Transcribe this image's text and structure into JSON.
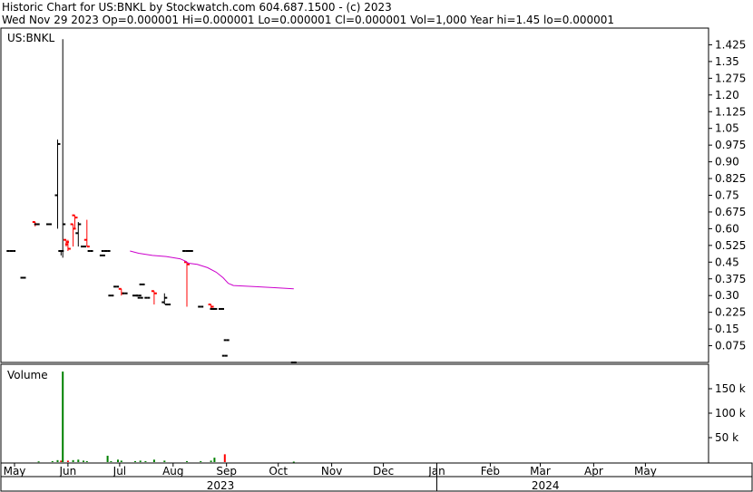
{
  "header": {
    "title": "Historic Chart for US:BNKL by Stockwatch.com 604.687.1500 - (c) 2023",
    "stats": "Wed Nov 29 2023   Op=0.000001  Hi=0.000001  Lo=0.000001  Cl=0.000001  Vol=1,000   Year hi=1.45  lo=0.000001"
  },
  "chart_data": [
    {
      "type": "ohlc",
      "symbol_label": "US:BNKL",
      "x_unit": "days since 2023-05-01",
      "ylim": [
        0,
        1.5
      ],
      "y_ticks": [
        "1.425",
        "1.35",
        "1.275",
        "1.20",
        "1.125",
        "1.05",
        "0.975",
        "0.90",
        "0.825",
        "0.75",
        "0.675",
        "0.60",
        "0.525",
        "0.45",
        "0.375",
        "0.30",
        "0.225",
        "0.15",
        "0.075"
      ],
      "y_tick_values": [
        1.425,
        1.35,
        1.275,
        1.2,
        1.125,
        1.05,
        0.975,
        0.9,
        0.825,
        0.75,
        0.675,
        0.6,
        0.525,
        0.45,
        0.375,
        0.3,
        0.225,
        0.15,
        0.075
      ],
      "colors": {
        "up": "#000000",
        "down": "#ff0000",
        "moving_average": "#cc00cc"
      },
      "series": [
        {
          "name": "price",
          "bars": [
            {
              "d": -3,
              "o": 0.5,
              "h": 0.5,
              "l": 0.5,
              "c": 0.5
            },
            {
              "d": -1,
              "o": 0.5,
              "h": 0.5,
              "l": 0.5,
              "c": 0.5
            },
            {
              "d": 5,
              "o": 0.38,
              "h": 0.38,
              "l": 0.38,
              "c": 0.38
            },
            {
              "d": 12,
              "o": 0.63,
              "h": 0.63,
              "l": 0.61,
              "c": 0.62
            },
            {
              "d": 13,
              "o": 0.62,
              "h": 0.62,
              "l": 0.62,
              "c": 0.62
            },
            {
              "d": 20,
              "o": 0.62,
              "h": 0.62,
              "l": 0.62,
              "c": 0.62
            },
            {
              "d": 25,
              "o": 0.75,
              "h": 1.0,
              "l": 0.6,
              "c": 0.98
            },
            {
              "d": 27,
              "o": 0.5,
              "h": 0.5,
              "l": 0.48,
              "c": 0.5
            },
            {
              "d": 28,
              "o": 0.5,
              "h": 1.45,
              "l": 0.47,
              "c": 0.62
            },
            {
              "d": 30,
              "o": 0.55,
              "h": 0.55,
              "l": 0.52,
              "c": 0.54
            },
            {
              "d": 31,
              "o": 0.53,
              "h": 0.55,
              "l": 0.5,
              "c": 0.51
            },
            {
              "d": 34,
              "o": 0.62,
              "h": 0.62,
              "l": 0.52,
              "c": 0.6
            },
            {
              "d": 35,
              "o": 0.66,
              "h": 0.66,
              "l": 0.6,
              "c": 0.65
            },
            {
              "d": 37,
              "o": 0.58,
              "h": 0.63,
              "l": 0.52,
              "c": 0.62
            },
            {
              "d": 40,
              "o": 0.52,
              "h": 0.52,
              "l": 0.52,
              "c": 0.52
            },
            {
              "d": 42,
              "o": 0.55,
              "h": 0.64,
              "l": 0.52,
              "c": 0.52
            },
            {
              "d": 44,
              "o": 0.5,
              "h": 0.5,
              "l": 0.5,
              "c": 0.5
            },
            {
              "d": 51,
              "o": 0.48,
              "h": 0.48,
              "l": 0.48,
              "c": 0.48
            },
            {
              "d": 52,
              "o": 0.5,
              "h": 0.5,
              "l": 0.5,
              "c": 0.5
            },
            {
              "d": 54,
              "o": 0.5,
              "h": 0.5,
              "l": 0.5,
              "c": 0.5
            },
            {
              "d": 56,
              "o": 0.3,
              "h": 0.3,
              "l": 0.3,
              "c": 0.3
            },
            {
              "d": 59,
              "o": 0.34,
              "h": 0.34,
              "l": 0.34,
              "c": 0.34
            },
            {
              "d": 62,
              "o": 0.33,
              "h": 0.33,
              "l": 0.3,
              "c": 0.31
            },
            {
              "d": 64,
              "o": 0.31,
              "h": 0.31,
              "l": 0.31,
              "c": 0.31
            },
            {
              "d": 70,
              "o": 0.3,
              "h": 0.3,
              "l": 0.3,
              "c": 0.3
            },
            {
              "d": 72,
              "o": 0.3,
              "h": 0.3,
              "l": 0.3,
              "c": 0.3
            },
            {
              "d": 73,
              "o": 0.29,
              "h": 0.29,
              "l": 0.29,
              "c": 0.29
            },
            {
              "d": 74,
              "o": 0.35,
              "h": 0.35,
              "l": 0.35,
              "c": 0.35
            },
            {
              "d": 77,
              "o": 0.29,
              "h": 0.29,
              "l": 0.29,
              "c": 0.29
            },
            {
              "d": 81,
              "o": 0.32,
              "h": 0.32,
              "l": 0.26,
              "c": 0.31
            },
            {
              "d": 87,
              "o": 0.27,
              "h": 0.31,
              "l": 0.26,
              "c": 0.29
            },
            {
              "d": 89,
              "o": 0.26,
              "h": 0.26,
              "l": 0.26,
              "c": 0.26
            },
            {
              "d": 99,
              "o": 0.5,
              "h": 0.5,
              "l": 0.5,
              "c": 0.5
            },
            {
              "d": 100,
              "o": 0.45,
              "h": 0.45,
              "l": 0.25,
              "c": 0.44
            },
            {
              "d": 101,
              "o": 0.5,
              "h": 0.5,
              "l": 0.5,
              "c": 0.5
            },
            {
              "d": 102,
              "o": 0.5,
              "h": 0.5,
              "l": 0.5,
              "c": 0.5
            },
            {
              "d": 108,
              "o": 0.25,
              "h": 0.25,
              "l": 0.25,
              "c": 0.25
            },
            {
              "d": 114,
              "o": 0.26,
              "h": 0.26,
              "l": 0.24,
              "c": 0.25
            },
            {
              "d": 115,
              "o": 0.24,
              "h": 0.24,
              "l": 0.24,
              "c": 0.24
            },
            {
              "d": 116,
              "o": 0.24,
              "h": 0.24,
              "l": 0.24,
              "c": 0.24
            },
            {
              "d": 120,
              "o": 0.24,
              "h": 0.24,
              "l": 0.24,
              "c": 0.24
            },
            {
              "d": 122,
              "o": 0.03,
              "h": 0.03,
              "l": 0.03,
              "c": 0.03
            },
            {
              "d": 123,
              "o": 0.1,
              "h": 0.1,
              "l": 0.1,
              "c": 0.1
            },
            {
              "d": 162,
              "o": 1e-06,
              "h": 1e-06,
              "l": 1e-06,
              "c": 1e-06
            }
          ]
        },
        {
          "name": "moving average",
          "points": [
            {
              "d": 67,
              "v": 0.5
            },
            {
              "d": 72,
              "v": 0.49
            },
            {
              "d": 80,
              "v": 0.48
            },
            {
              "d": 88,
              "v": 0.475
            },
            {
              "d": 96,
              "v": 0.465
            },
            {
              "d": 99,
              "v": 0.455
            },
            {
              "d": 101,
              "v": 0.445
            },
            {
              "d": 106,
              "v": 0.44
            },
            {
              "d": 112,
              "v": 0.425
            },
            {
              "d": 117,
              "v": 0.405
            },
            {
              "d": 121,
              "v": 0.38
            },
            {
              "d": 124,
              "v": 0.355
            },
            {
              "d": 127,
              "v": 0.345
            },
            {
              "d": 140,
              "v": 0.34
            },
            {
              "d": 152,
              "v": 0.335
            },
            {
              "d": 162,
              "v": 0.33
            }
          ]
        }
      ]
    },
    {
      "type": "bar",
      "label": "Volume",
      "ylim": [
        0,
        200000
      ],
      "y_ticks": [
        "150 k",
        "100 k",
        "50 k"
      ],
      "y_tick_values": [
        150000,
        100000,
        50000
      ],
      "colors": {
        "volume": "#008000",
        "volume_down": "#ff0000"
      },
      "series": [
        {
          "name": "volume",
          "bars": [
            {
              "d": 14,
              "v": 1500,
              "c": "green"
            },
            {
              "d": 22,
              "v": 2000,
              "c": "green"
            },
            {
              "d": 25,
              "v": 4000,
              "c": "green"
            },
            {
              "d": 27,
              "v": 3000,
              "c": "red"
            },
            {
              "d": 28,
              "v": 185000,
              "c": "green"
            },
            {
              "d": 31,
              "v": 3000,
              "c": "red"
            },
            {
              "d": 34,
              "v": 4000,
              "c": "green"
            },
            {
              "d": 37,
              "v": 5000,
              "c": "green"
            },
            {
              "d": 40,
              "v": 3000,
              "c": "green"
            },
            {
              "d": 42,
              "v": 2000,
              "c": "green"
            },
            {
              "d": 54,
              "v": 13000,
              "c": "green"
            },
            {
              "d": 56,
              "v": 2000,
              "c": "green"
            },
            {
              "d": 60,
              "v": 5000,
              "c": "green"
            },
            {
              "d": 62,
              "v": 3000,
              "c": "green"
            },
            {
              "d": 70,
              "v": 2000,
              "c": "green"
            },
            {
              "d": 73,
              "v": 3000,
              "c": "green"
            },
            {
              "d": 76,
              "v": 2000,
              "c": "green"
            },
            {
              "d": 81,
              "v": 5000,
              "c": "green"
            },
            {
              "d": 87,
              "v": 3000,
              "c": "green"
            },
            {
              "d": 100,
              "v": 2000,
              "c": "green"
            },
            {
              "d": 108,
              "v": 2000,
              "c": "green"
            },
            {
              "d": 114,
              "v": 3000,
              "c": "green"
            },
            {
              "d": 116,
              "v": 9000,
              "c": "green"
            },
            {
              "d": 122,
              "v": 16000,
              "c": "red"
            },
            {
              "d": 162,
              "v": 1000,
              "c": "green"
            }
          ]
        }
      ]
    }
  ],
  "x_axis": {
    "months": [
      {
        "label": "May",
        "d": 0
      },
      {
        "label": "Jun",
        "d": 31
      },
      {
        "label": "Jul",
        "d": 61
      },
      {
        "label": "Aug",
        "d": 92
      },
      {
        "label": "Sep",
        "d": 123
      },
      {
        "label": "Oct",
        "d": 153
      },
      {
        "label": "Nov",
        "d": 184
      },
      {
        "label": "Dec",
        "d": 214
      },
      {
        "label": "Jan",
        "d": 245
      },
      {
        "label": "Feb",
        "d": 276
      },
      {
        "label": "Mar",
        "d": 305
      },
      {
        "label": "Apr",
        "d": 336
      },
      {
        "label": "May",
        "d": 366
      }
    ],
    "years": [
      {
        "label": "2023",
        "start": -6,
        "end": 245
      },
      {
        "label": "2024",
        "start": 245,
        "end": 371
      }
    ]
  }
}
